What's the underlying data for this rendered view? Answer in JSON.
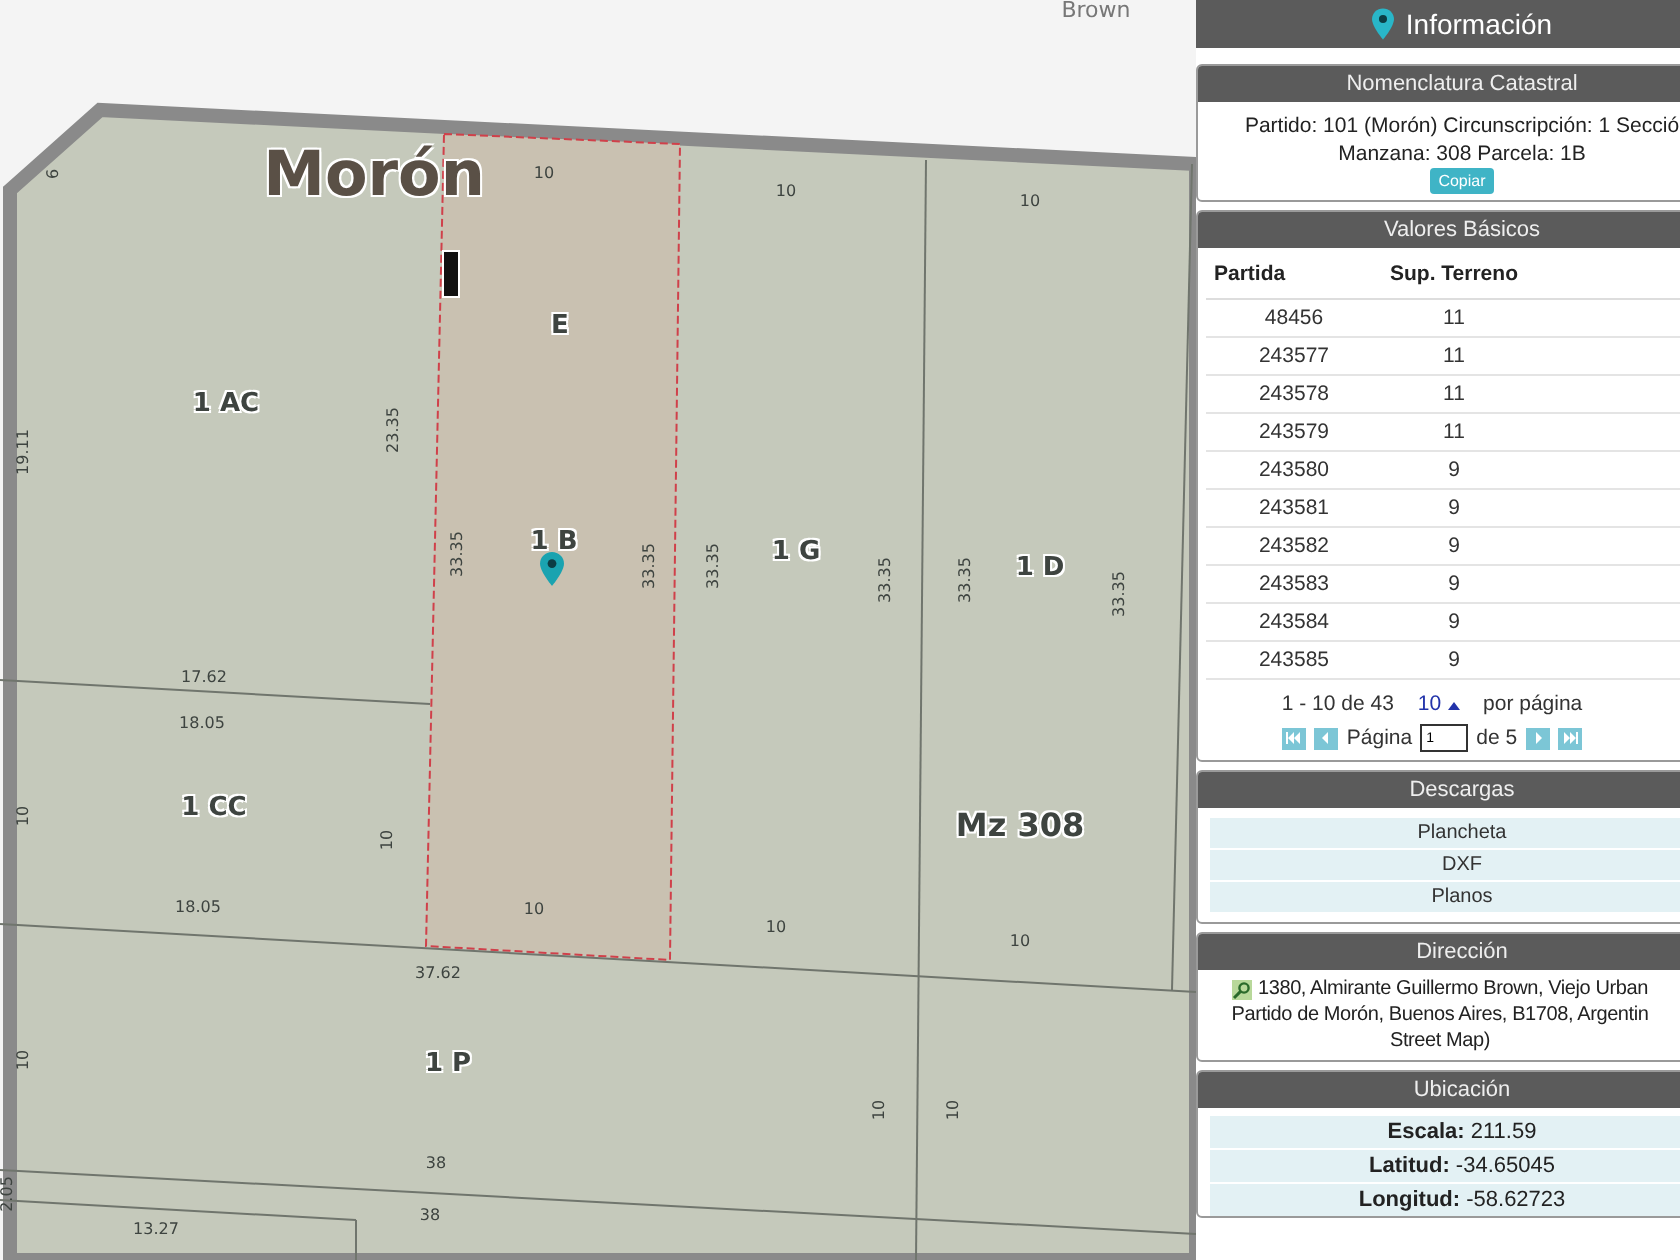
{
  "map": {
    "labels": [
      {
        "text": "Brown",
        "kind": "street"
      },
      {
        "text": "Morón",
        "kind": "locality"
      },
      {
        "text": "10",
        "kind": "dimension"
      },
      {
        "text": "10",
        "kind": "dimension"
      },
      {
        "text": "10",
        "kind": "dimension"
      },
      {
        "text": "6",
        "kind": "dimension"
      },
      {
        "text": "E",
        "kind": "parcel"
      },
      {
        "text": "1 AC",
        "kind": "parcel"
      },
      {
        "text": "23.35",
        "kind": "dimension"
      },
      {
        "text": "19.11",
        "kind": "dimension"
      },
      {
        "text": "33.35",
        "kind": "dimension"
      },
      {
        "text": "1 B",
        "kind": "parcel"
      },
      {
        "text": "33.35",
        "kind": "dimension"
      },
      {
        "text": "33.35",
        "kind": "dimension"
      },
      {
        "text": "1 G",
        "kind": "parcel"
      },
      {
        "text": "33.35",
        "kind": "dimension"
      },
      {
        "text": "33.35",
        "kind": "dimension"
      },
      {
        "text": "1 D",
        "kind": "parcel"
      },
      {
        "text": "33.35",
        "kind": "dimension"
      },
      {
        "text": "17.62",
        "kind": "dimension"
      },
      {
        "text": "18.05",
        "kind": "dimension"
      },
      {
        "text": "10",
        "kind": "dimension"
      },
      {
        "text": "1 CC",
        "kind": "parcel"
      },
      {
        "text": "10",
        "kind": "dimension"
      },
      {
        "text": "Mz 308",
        "kind": "block"
      },
      {
        "text": "18.05",
        "kind": "dimension"
      },
      {
        "text": "10",
        "kind": "dimension"
      },
      {
        "text": "10",
        "kind": "dimension"
      },
      {
        "text": "10",
        "kind": "dimension"
      },
      {
        "text": "37.62",
        "kind": "dimension"
      },
      {
        "text": "10",
        "kind": "dimension"
      },
      {
        "text": "1 P",
        "kind": "parcel"
      },
      {
        "text": "10",
        "kind": "dimension"
      },
      {
        "text": "10",
        "kind": "dimension"
      },
      {
        "text": "38",
        "kind": "dimension"
      },
      {
        "text": "2.05",
        "kind": "dimension"
      },
      {
        "text": "13.27",
        "kind": "dimension"
      },
      {
        "text": "38",
        "kind": "dimension"
      }
    ]
  },
  "panel": {
    "title": "Información",
    "nomenclatura": {
      "title": "Nomenclatura Catastral",
      "lines": [
        "Partido: 101 (Morón) Circunscripción: 1 Secció",
        "Manzana: 308 Parcela: 1B"
      ],
      "copy_button": "Copiar"
    },
    "valores": {
      "title": "Valores Básicos",
      "columns": [
        "Partida",
        "Sup. Terreno"
      ],
      "rows": [
        [
          "48456",
          "11"
        ],
        [
          "243577",
          "11"
        ],
        [
          "243578",
          "11"
        ],
        [
          "243579",
          "11"
        ],
        [
          "243580",
          "9"
        ],
        [
          "243581",
          "9"
        ],
        [
          "243582",
          "9"
        ],
        [
          "243583",
          "9"
        ],
        [
          "243584",
          "9"
        ],
        [
          "243585",
          "9"
        ]
      ],
      "range": "1 - 10 de 43",
      "page_size": "10",
      "per_page": "por página",
      "page_label": "Página",
      "page": "1",
      "page_total": "de 5"
    },
    "descargas": {
      "title": "Descargas",
      "links": [
        "Plancheta",
        "DXF",
        "Planos"
      ]
    },
    "direccion": {
      "title": "Dirección",
      "lines": [
        "1380, Almirante Guillermo Brown, Viejo Urban",
        "Partido de Morón, Buenos Aires, B1708, Argentin",
        "Street Map)"
      ]
    },
    "ubicacion": {
      "title": "Ubicación",
      "rows": [
        {
          "label": "Escala:",
          "value": "211.59"
        },
        {
          "label": "Latitud:",
          "value": "-34.65045"
        },
        {
          "label": "Longitud:",
          "value": "-58.62723"
        }
      ]
    }
  }
}
